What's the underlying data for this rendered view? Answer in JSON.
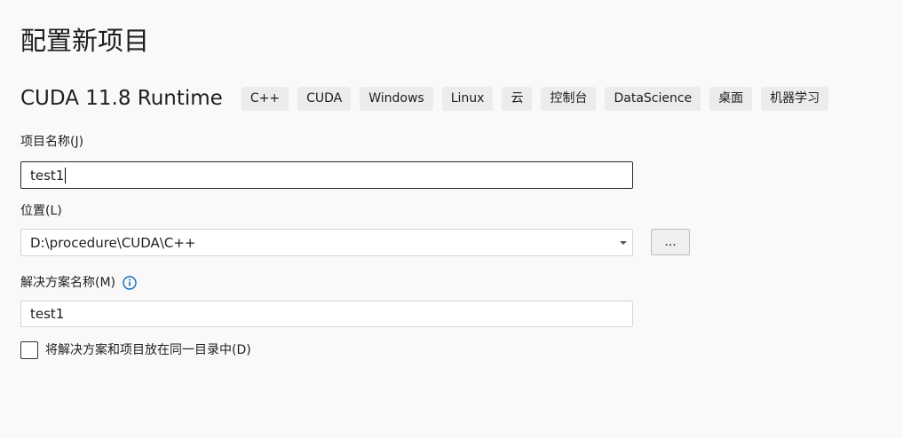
{
  "page": {
    "title": "配置新项目"
  },
  "template": {
    "name": "CUDA 11.8 Runtime",
    "tags": [
      "C++",
      "CUDA",
      "Windows",
      "Linux",
      "云",
      "控制台",
      "DataScience",
      "桌面",
      "机器学习"
    ]
  },
  "project_name": {
    "label": "项目名称(J)",
    "value": "test1"
  },
  "location": {
    "label": "位置(L)",
    "value": "D:\\procedure\\CUDA\\C++",
    "browse_label": "..."
  },
  "solution_name": {
    "label": "解决方案名称(M)",
    "value": "test1",
    "info_icon": "info-circle-icon"
  },
  "same_directory": {
    "label": "将解决方案和项目放在同一目录中(D)",
    "checked": false
  },
  "colors": {
    "background": "#f9f9f9",
    "tag_background": "#ececec",
    "info_icon": "#0f6cbd"
  }
}
